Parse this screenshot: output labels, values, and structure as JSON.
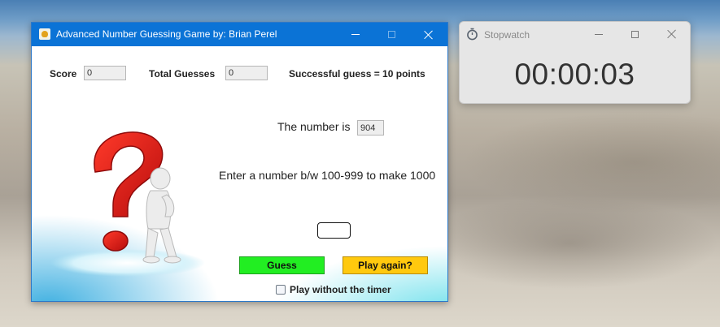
{
  "game_window": {
    "title": "Advanced Number Guessing Game by: Brian Perel",
    "icon": "app-icon",
    "controls": [
      "minimize-icon",
      "maximize-icon",
      "close-icon"
    ],
    "score_label": "Score",
    "score_value": "0",
    "total_guesses_label": "Total Guesses",
    "total_guesses_value": "0",
    "rule_text": "Successful guess = 10 points",
    "number_label": "The number is",
    "number_value": "904",
    "instruction": "Enter a number b/w 100-999 to make 1000",
    "guess_input_value": "",
    "guess_button": "Guess",
    "play_again_button": "Play again?",
    "timer_checkbox_label": "Play without the timer",
    "timer_checkbox_checked": false,
    "illustration": "question-mark-figure",
    "colors": {
      "titlebar": "#0b73d6",
      "guess_button": "#22ee22",
      "play_again_button": "#ffc90e"
    }
  },
  "stopwatch_window": {
    "title": "Stopwatch",
    "icon": "stopwatch-icon",
    "controls": [
      "minimize-icon",
      "maximize-icon",
      "close-icon"
    ],
    "time": "00:00:03"
  }
}
